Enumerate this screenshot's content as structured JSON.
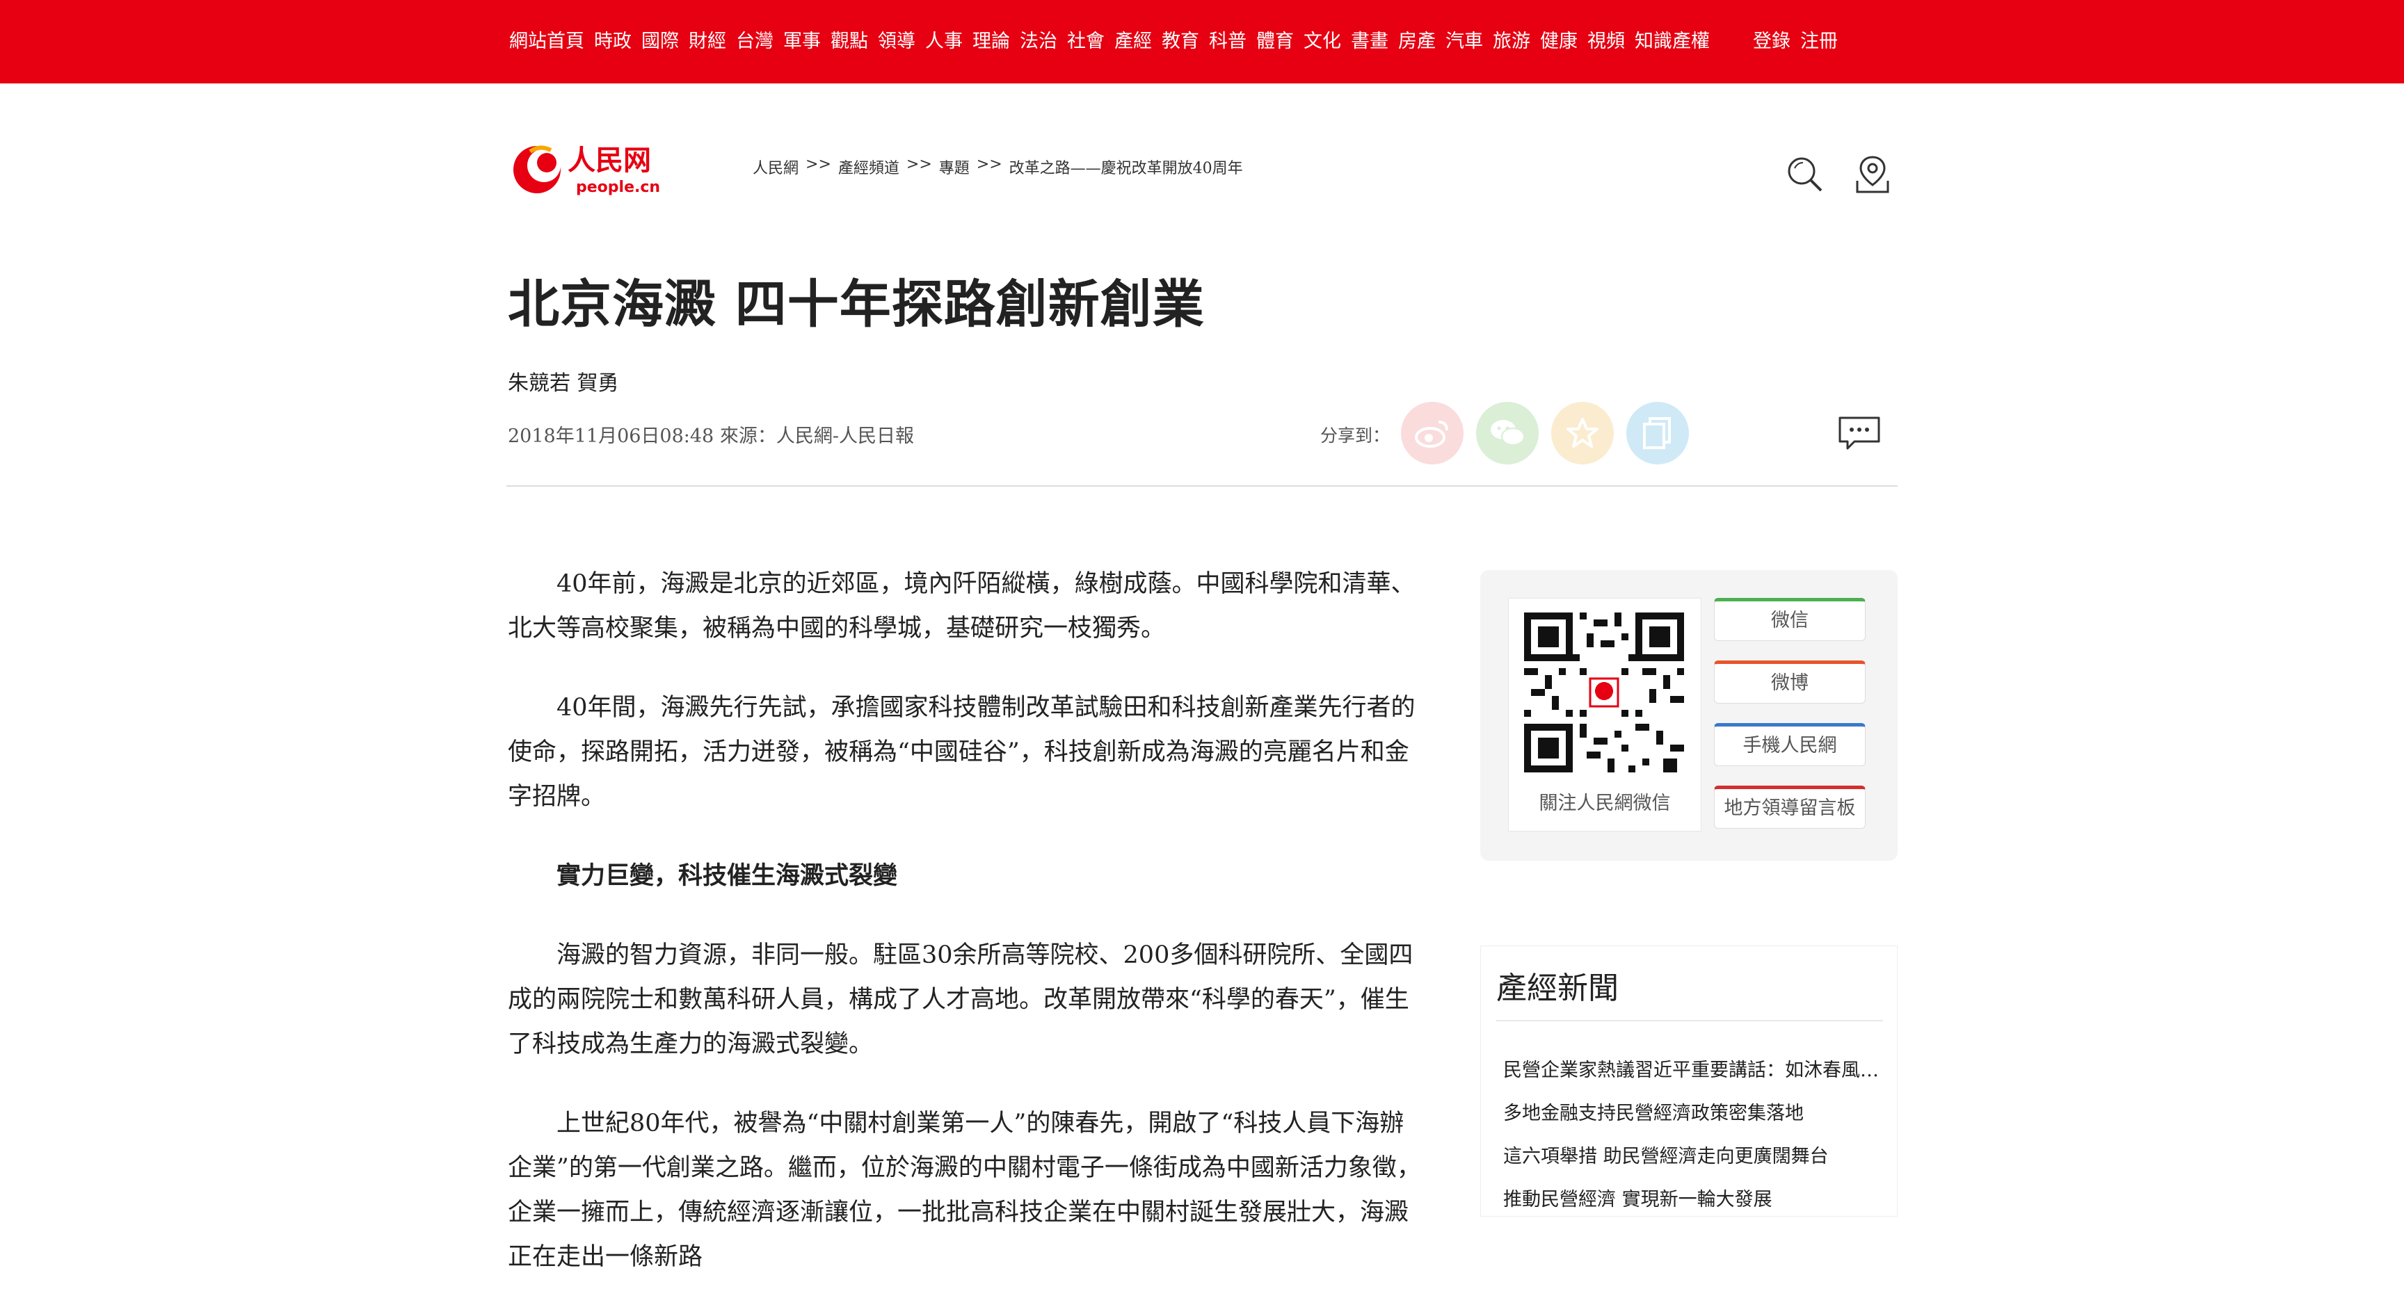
{
  "topnav": {
    "items": [
      "網站首頁",
      "時政",
      "國際",
      "財經",
      "台灣",
      "軍事",
      "觀點",
      "領導",
      "人事",
      "理論",
      "法治",
      "社會",
      "產經",
      "教育",
      "科普",
      "體育",
      "文化",
      "書畫",
      "房產",
      "汽車",
      "旅游",
      "健康",
      "視頻",
      "知識產權"
    ],
    "login": "登錄",
    "register": "注冊"
  },
  "logo": {
    "name": "人民网",
    "domain": "people.cn"
  },
  "breadcrumb": {
    "items": [
      "人民網",
      "產經頻道",
      "專題",
      "改革之路——慶祝改革開放40周年"
    ],
    "separator": ">>"
  },
  "icons": {
    "search": "search-icon",
    "location": "location-icon",
    "comment": "comment-icon"
  },
  "article": {
    "title": "北京海澱 四十年探路創新創業",
    "authors": "朱競若  賀勇",
    "meta": "2018年11月06日08:48  來源：人民網-人民日報",
    "share_label": "分享到：",
    "paragraphs": [
      "40年前，海澱是北京的近郊區，境內阡陌縱橫，綠樹成蔭。中國科學院和清華、北大等高校聚集，被稱為中國的科學城，基礎研究一枝獨秀。",
      "40年間，海澱先行先試，承擔國家科技體制改革試驗田和科技創新產業先行者的使命，探路開拓，活力迸發，被稱為“中國硅谷”，科技創新成為海澱的亮麗名片和金字招牌。",
      "實力巨變，科技催生海澱式裂變",
      "海澱的智力資源，非同一般。駐區30余所高等院校、200多個科研院所、全國四成的兩院院士和數萬科研人員，構成了人才高地。改革開放帶來“科學的春天”，催生了科技成為生產力的海澱式裂變。",
      "上世紀80年代，被譽為“中關村創業第一人”的陳春先，開啟了“科技人員下海辦企業”的第一代創業之路。繼而，位於海澱的中關村電子一條街成為中國新活力象徵，企業一擁而上，傳統經濟逐漸讓位，一批批高科技企業在中關村誕生發展壯大，海澱正在走出一條新路"
    ]
  },
  "share": {
    "colors": {
      "weibo": "#fadcdc",
      "wechat": "#dbeed6",
      "favorite": "#fbecd0",
      "copy": "#cfeaf6"
    }
  },
  "follow": {
    "qr_caption": "關注人民網微信",
    "buttons": [
      {
        "label": "微信",
        "color": "#4caf50"
      },
      {
        "label": "微博",
        "color": "#e8542b"
      },
      {
        "label": "手機人民網",
        "color": "#3a78c9"
      },
      {
        "label": "地方領導留言板",
        "color": "#d32f2f"
      }
    ]
  },
  "news": {
    "title": "產經新聞",
    "items": [
      "民營企業家熱議習近平重要講話：如沐春風 倍受鼓舞",
      "多地金融支持民營經濟政策密集落地",
      "這六項舉措 助民營經濟走向更廣闊舞台",
      "推動民營經濟 實現新一輪大發展"
    ]
  },
  "colors": {
    "brand_red": "#e60012"
  }
}
